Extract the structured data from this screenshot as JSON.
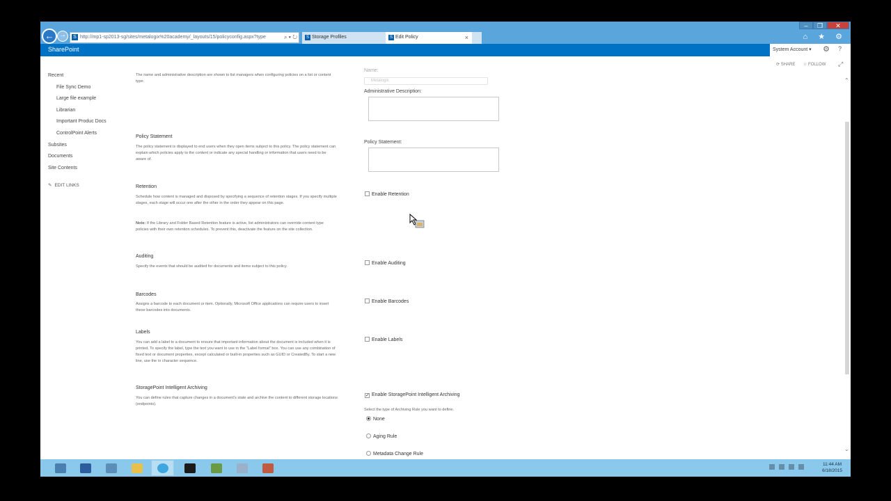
{
  "browser": {
    "url": "http://mp1-sp2013-sg/sites/metalogix%20academy/_layouts/15/policyconfig.aspx?type",
    "address_tools": "⌕ ▾ ↻",
    "tabs": [
      {
        "label": "Storage Profiles"
      },
      {
        "label": "Edit Policy"
      }
    ],
    "tab_close": "×",
    "tray_icons": "⌂ ★ ⚙"
  },
  "suite": {
    "brand": "SharePoint",
    "account": "System Account ▾",
    "gear": "⚙",
    "help": "?",
    "share": "SHARE",
    "follow": "FOLLOW",
    "focus": "⤢"
  },
  "nav": {
    "recent": "Recent",
    "recent_items": [
      "File Sync Demo",
      "Large file example",
      "Librarian",
      "Important Produc Docs",
      "ControlPoint Alerts"
    ],
    "subsites": "Subsites",
    "documents": "Documents",
    "site_contents": "Site Contents",
    "edit_links": "EDIT LINKS"
  },
  "sections": {
    "name_desc": "The name and administrative description are shown to list managers when configuring policies on a list or content type.",
    "name_label": "Name:",
    "name_value": "Metalogix",
    "admin_desc_label": "Administrative Description:",
    "policy_statement": {
      "title": "Policy Statement",
      "desc": "The policy statement is displayed to end users when they open items subject to this policy. The policy statement can explain which policies apply to the content or indicate any special handling or information that users need to be aware of.",
      "label": "Policy Statement:"
    },
    "retention": {
      "title": "Retention",
      "desc": "Schedule how content is managed and disposed by specifying a sequence of retention stages. If you specify multiple stages, each stage will occur one after the other in the order they appear on this page.",
      "note_bold": "Note:",
      "note": " If the Library and Folder Based Retention feature is active, list administrators can override content type policies with their own retention schedules. To prevent this, deactivate the feature on the site collection.",
      "checkbox": "Enable Retention"
    },
    "auditing": {
      "title": "Auditing",
      "desc": "Specify the events that should be audited for documents and items subject to this policy.",
      "checkbox": "Enable Auditing"
    },
    "barcodes": {
      "title": "Barcodes",
      "desc": "Assigns a barcode to each document or item. Optionally, Microsoft Office applications can require users to insert these barcodes into documents.",
      "checkbox": "Enable Barcodes"
    },
    "labels": {
      "title": "Labels",
      "desc": "You can add a label to a document to ensure that important information about the document is included when it is printed. To specify the label, type the text you want to use in the \"Label format\" box. You can use any combination of fixed text or document properties, except calculated or built-in properties such as GUID or CreatedBy. To start a new line, use the \\n character sequence.",
      "checkbox": "Enable Labels"
    },
    "archiving": {
      "title": "StoragePoint Intelligent Archiving",
      "desc": "You can define rules that capture changes in a document's state and archive the content to different storage locations (endpoints).",
      "checkbox": "Enable StoragePoint Intelligent Archiving",
      "checked": true,
      "prompt": "Select the type of Archiving Rule you want to define.",
      "options": [
        "None",
        "Aging Rule",
        "Metadata Change Rule"
      ],
      "selected": "None"
    }
  },
  "taskbar": {
    "clock_time": "11:44 AM",
    "clock_date": "6/18/2015",
    "apps": [
      {
        "name": "server-manager",
        "color": "#4a7fb1"
      },
      {
        "name": "powershell",
        "color": "#2c5d9c"
      },
      {
        "name": "explorer-window",
        "color": "#5b8fb9"
      },
      {
        "name": "file-explorer",
        "color": "#e8c04d"
      },
      {
        "name": "internet-explorer",
        "color": "#3fa7e0"
      },
      {
        "name": "command-prompt",
        "color": "#1a1a1a"
      },
      {
        "name": "sharepoint-tool",
        "color": "#6a9a44"
      },
      {
        "name": "mail-app",
        "color": "#9ab2c9"
      },
      {
        "name": "network-tool",
        "color": "#c05a41"
      }
    ]
  }
}
